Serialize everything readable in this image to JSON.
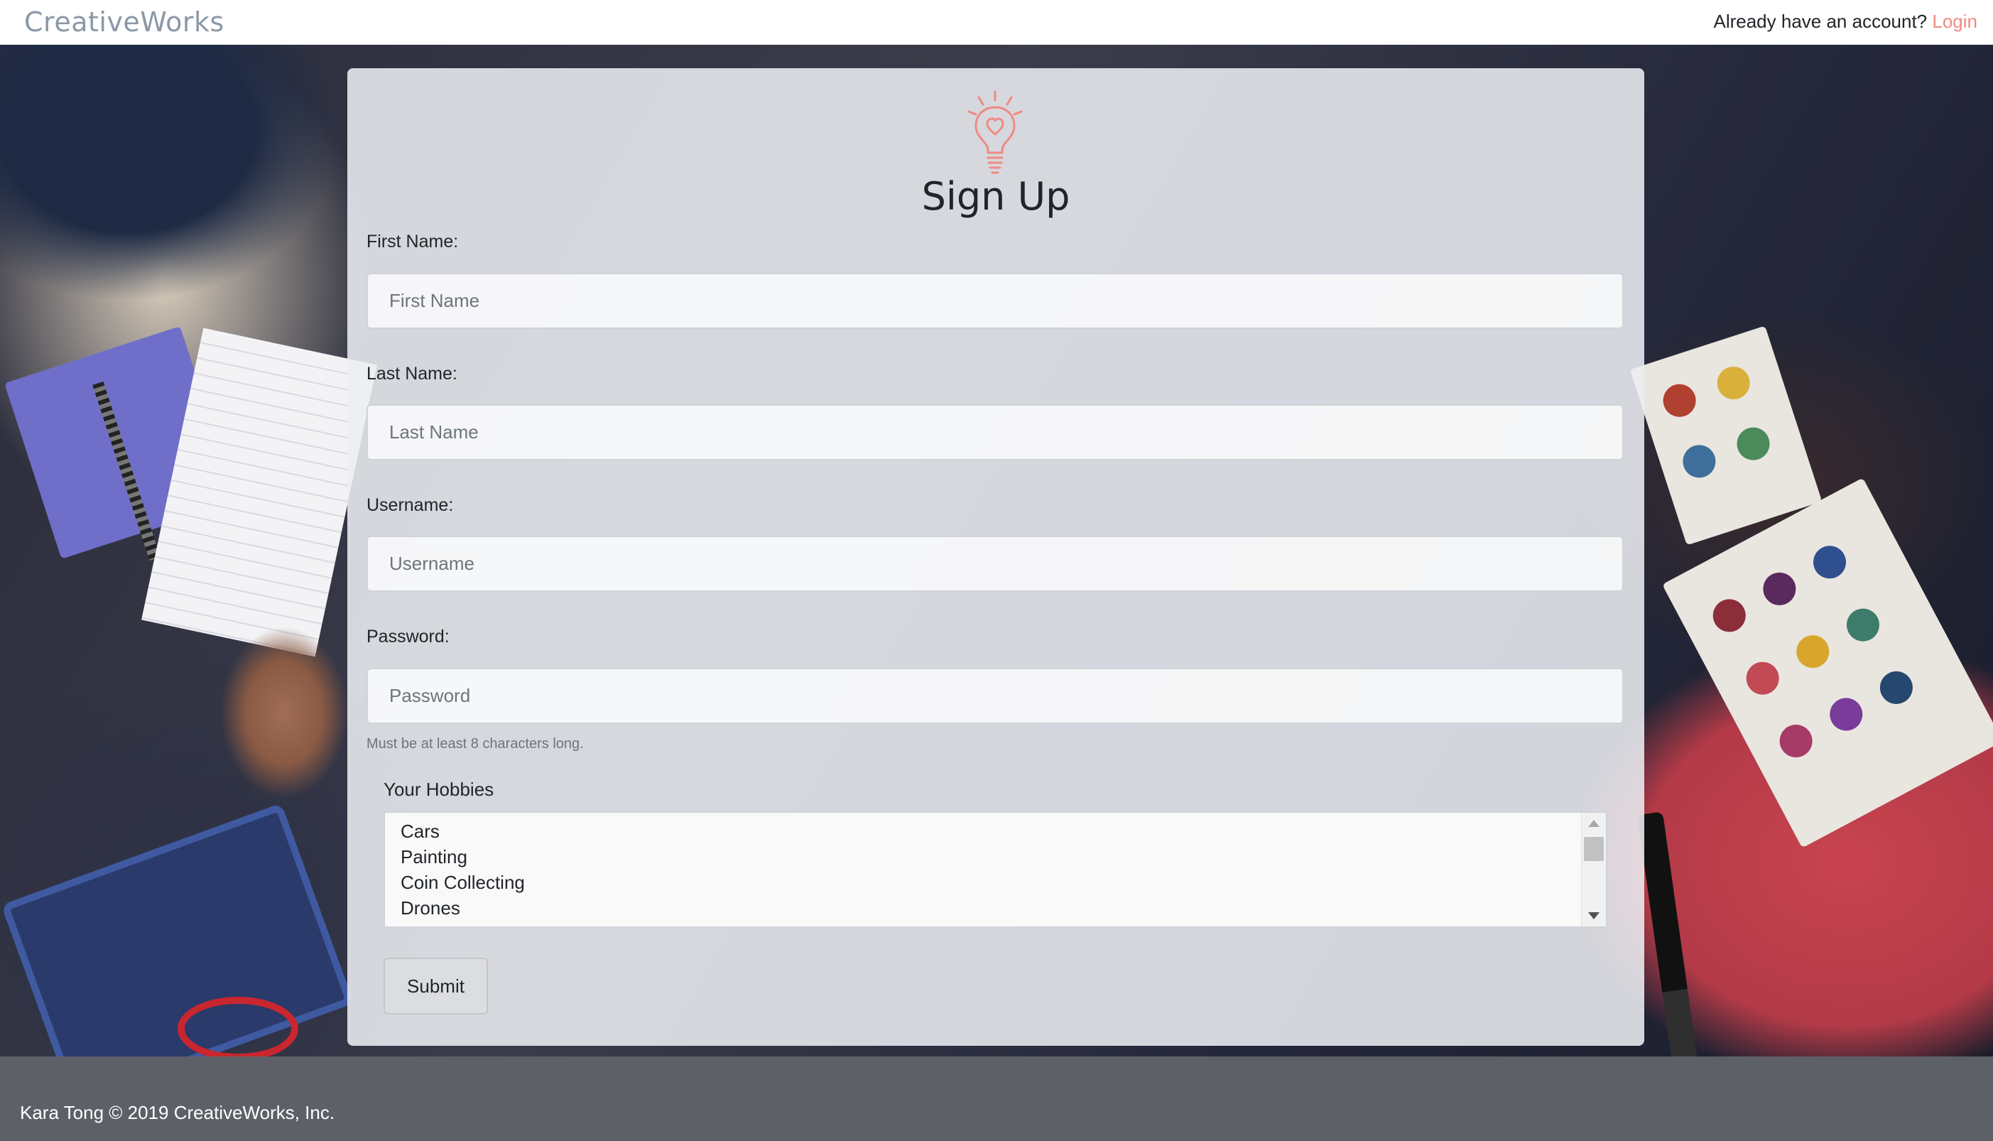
{
  "navbar": {
    "brand": "CreativeWorks",
    "account_prompt": "Already have an account?",
    "login_label": "Login"
  },
  "form": {
    "title": "Sign Up",
    "icon": "lightbulb-heart-icon",
    "first_name": {
      "label": "First Name:",
      "placeholder": "First Name",
      "value": ""
    },
    "last_name": {
      "label": "Last Name:",
      "placeholder": "Last Name",
      "value": ""
    },
    "username": {
      "label": "Username:",
      "placeholder": "Username",
      "value": ""
    },
    "password": {
      "label": "Password:",
      "placeholder": "Password",
      "value": "",
      "help": "Must be at least 8 characters long."
    },
    "hobbies": {
      "label": "Your Hobbies",
      "options": [
        "Cars",
        "Painting",
        "Coin Collecting",
        "Drones"
      ]
    },
    "submit_label": "Submit"
  },
  "footer": {
    "text": "Kara Tong © 2019 CreativeWorks, Inc."
  },
  "colors": {
    "accent": "#f08a83",
    "brand": "#8b98a6",
    "footer_bg": "#5e6068"
  }
}
